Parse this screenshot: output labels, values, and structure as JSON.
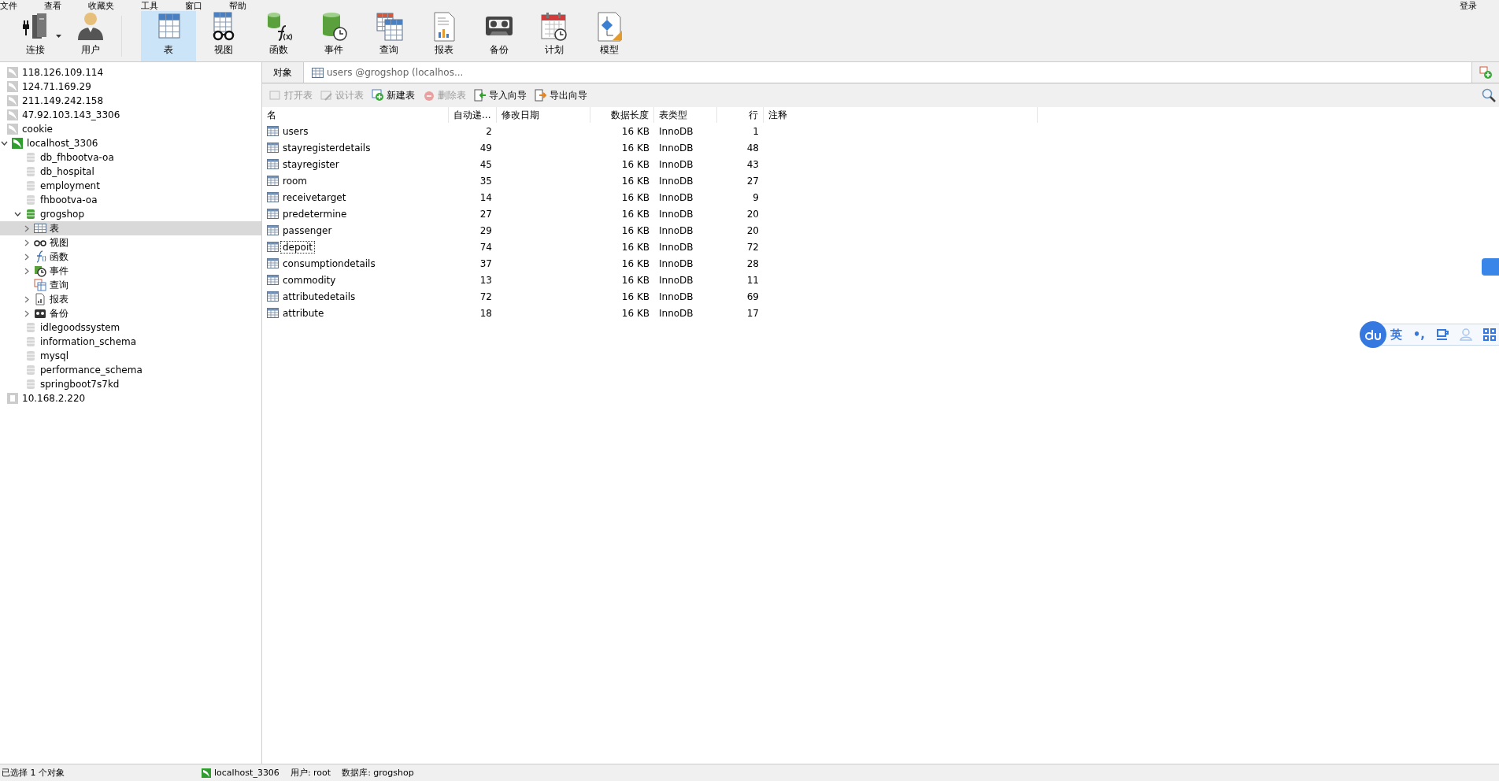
{
  "menu": [
    {
      "label": "文件"
    },
    {
      "label": "查看"
    },
    {
      "label": "收藏夹"
    },
    {
      "label": "工具"
    },
    {
      "label": "窗口"
    },
    {
      "label": "帮助"
    }
  ],
  "login": "登录",
  "toolbar": [
    {
      "label": "连接",
      "kind": "connection",
      "selected": false,
      "dropdown": true
    },
    {
      "label": "用户",
      "kind": "user",
      "selected": false
    },
    {
      "label": "表",
      "kind": "table",
      "selected": true
    },
    {
      "label": "视图",
      "kind": "view",
      "selected": false
    },
    {
      "label": "函数",
      "kind": "function",
      "selected": false
    },
    {
      "label": "事件",
      "kind": "event",
      "selected": false
    },
    {
      "label": "查询",
      "kind": "query",
      "selected": false
    },
    {
      "label": "报表",
      "kind": "report",
      "selected": false
    },
    {
      "label": "备份",
      "kind": "backup",
      "selected": false
    },
    {
      "label": "计划",
      "kind": "schedule",
      "selected": false
    },
    {
      "label": "模型",
      "kind": "model",
      "selected": false
    }
  ],
  "sidebar": {
    "items": [
      {
        "label": "118.126.109.114",
        "kind": "server",
        "connected": false,
        "selected": false
      },
      {
        "label": "124.71.169.29",
        "kind": "server",
        "connected": false,
        "selected": false
      },
      {
        "label": "211.149.242.158",
        "kind": "server",
        "connected": false,
        "selected": false
      },
      {
        "label": "47.92.103.143_3306",
        "kind": "server",
        "connected": false,
        "selected": false
      },
      {
        "label": "cookie",
        "kind": "server",
        "connected": false,
        "selected": false
      },
      {
        "label": "localhost_3306",
        "kind": "server",
        "connected": true,
        "selected": false,
        "expanded": true,
        "children": [
          {
            "label": "db_fhbootva-oa",
            "kind": "database",
            "connected": false,
            "selected": false
          },
          {
            "label": "db_hospital",
            "kind": "database",
            "connected": false,
            "selected": false
          },
          {
            "label": "employment",
            "kind": "database",
            "connected": false,
            "selected": false
          },
          {
            "label": "fhbootva-oa",
            "kind": "database",
            "connected": false,
            "selected": false
          },
          {
            "label": "grogshop",
            "kind": "database",
            "connected": true,
            "selected": false,
            "expanded": true,
            "children": [
              {
                "label": "表",
                "kind": "tables",
                "selected": true,
                "expanded": false
              },
              {
                "label": "视图",
                "kind": "views",
                "selected": false,
                "expanded": false
              },
              {
                "label": "函数",
                "kind": "functions",
                "selected": false,
                "expanded": false
              },
              {
                "label": "事件",
                "kind": "events",
                "selected": false,
                "expanded": false
              },
              {
                "label": "查询",
                "kind": "queries",
                "selected": false
              },
              {
                "label": "报表",
                "kind": "reports",
                "selected": false,
                "expanded": false
              },
              {
                "label": "备份",
                "kind": "backups",
                "selected": false,
                "expanded": false
              }
            ]
          },
          {
            "label": "idlegoodssystem",
            "kind": "database",
            "connected": false,
            "selected": false
          },
          {
            "label": "information_schema",
            "kind": "database",
            "connected": false,
            "selected": false
          },
          {
            "label": "mysql",
            "kind": "database",
            "connected": false,
            "selected": false
          },
          {
            "label": "performance_schema",
            "kind": "database",
            "connected": false,
            "selected": false
          },
          {
            "label": "springboot7s7kd",
            "kind": "database",
            "connected": false,
            "selected": false
          }
        ]
      },
      {
        "label": "10.168.2.220",
        "kind": "remote",
        "connected": false,
        "selected": false
      }
    ]
  },
  "tabs": [
    {
      "label": "对象",
      "kind": "objects",
      "selected": false
    },
    {
      "label": "users @grogshop (localhos...",
      "kind": "table",
      "selected": true
    }
  ],
  "actions": [
    {
      "label": "打开表",
      "kind": "open",
      "disabled": true
    },
    {
      "label": "设计表",
      "kind": "design",
      "disabled": true
    },
    {
      "label": "新建表",
      "kind": "new",
      "disabled": false
    },
    {
      "label": "删除表",
      "kind": "delete",
      "disabled": true
    },
    {
      "label": "导入向导",
      "kind": "import",
      "disabled": false
    },
    {
      "label": "导出向导",
      "kind": "export",
      "disabled": false
    }
  ],
  "table": {
    "columns": [
      {
        "label": "名"
      },
      {
        "label": "自动递..."
      },
      {
        "label": "修改日期"
      },
      {
        "label": "数据长度"
      },
      {
        "label": "表类型"
      },
      {
        "label": "行"
      },
      {
        "label": "注释"
      }
    ],
    "rows": [
      {
        "name": "users",
        "auto_increment": "2",
        "data_length": "16 KB",
        "engine": "InnoDB",
        "rows": "1",
        "focused": false
      },
      {
        "name": "stayregisterdetails",
        "auto_increment": "49",
        "data_length": "16 KB",
        "engine": "InnoDB",
        "rows": "48",
        "focused": false
      },
      {
        "name": "stayregister",
        "auto_increment": "45",
        "data_length": "16 KB",
        "engine": "InnoDB",
        "rows": "43",
        "focused": false
      },
      {
        "name": "room",
        "auto_increment": "35",
        "data_length": "16 KB",
        "engine": "InnoDB",
        "rows": "27",
        "focused": false
      },
      {
        "name": "receivetarget",
        "auto_increment": "14",
        "data_length": "16 KB",
        "engine": "InnoDB",
        "rows": "9",
        "focused": false
      },
      {
        "name": "predetermine",
        "auto_increment": "27",
        "data_length": "16 KB",
        "engine": "InnoDB",
        "rows": "20",
        "focused": false
      },
      {
        "name": "passenger",
        "auto_increment": "29",
        "data_length": "16 KB",
        "engine": "InnoDB",
        "rows": "20",
        "focused": false
      },
      {
        "name": "depoit",
        "auto_increment": "74",
        "data_length": "16 KB",
        "engine": "InnoDB",
        "rows": "72",
        "focused": true
      },
      {
        "name": "consumptiondetails",
        "auto_increment": "37",
        "data_length": "16 KB",
        "engine": "InnoDB",
        "rows": "28",
        "focused": false
      },
      {
        "name": "commodity",
        "auto_increment": "13",
        "data_length": "16 KB",
        "engine": "InnoDB",
        "rows": "11",
        "focused": false
      },
      {
        "name": "attributedetails",
        "auto_increment": "72",
        "data_length": "16 KB",
        "engine": "InnoDB",
        "rows": "69",
        "focused": false
      },
      {
        "name": "attribute",
        "auto_increment": "18",
        "data_length": "16 KB",
        "engine": "InnoDB",
        "rows": "17",
        "focused": false
      }
    ]
  },
  "ime": [
    {
      "label": "英",
      "kind": "text"
    },
    {
      "label": "•,",
      "kind": "text"
    },
    {
      "kind": "keyboard"
    },
    {
      "kind": "user"
    },
    {
      "kind": "grid"
    }
  ],
  "status_bar": [
    {
      "label": "已选择 1 个对象",
      "kind": "text"
    },
    {
      "label": "localhost_3306",
      "kind": "connection"
    },
    {
      "label": "用户: root",
      "kind": "text"
    },
    {
      "label": "数据库: grogshop",
      "kind": "text"
    }
  ]
}
